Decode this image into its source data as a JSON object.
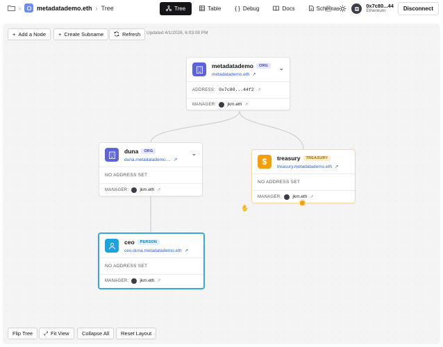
{
  "breadcrumb": {
    "name": "metadatademo.eth",
    "page": "Tree"
  },
  "nav": {
    "tabs": [
      {
        "label": "Tree",
        "icon": "tree-icon"
      },
      {
        "label": "Table",
        "icon": "table-icon"
      },
      {
        "label": "Debug",
        "icon": "code-icon"
      },
      {
        "label": "Docs",
        "icon": "book-icon"
      },
      {
        "label": "Schemas",
        "icon": "document-icon"
      }
    ]
  },
  "account": {
    "address": "0x7c80...44",
    "network": "Ethereum",
    "disconnect_label": "Disconnect"
  },
  "toolbar": {
    "add_node": "Add a Node",
    "create_subname": "Create Subname",
    "refresh": "Refresh",
    "updated": "Updated 4/1/2026, 6:03:08 PM"
  },
  "footer": {
    "flip_tree": "Flip Tree",
    "fit_view": "Fit View",
    "collapse_all": "Collapse All",
    "reset_layout": "Reset Layout"
  },
  "nodes": {
    "root": {
      "name": "metadatademo",
      "tag": "ORG",
      "sub": "metadatademo.eth",
      "address_label": "ADDRESS:",
      "address": "0x7c80...44f2",
      "manager_label": "MANAGER:",
      "manager": "jkm.eth"
    },
    "duna": {
      "name": "duna",
      "tag": "ORG",
      "sub": "duna.metadatademo....",
      "address": "NO ADDRESS SET",
      "manager_label": "MANAGER:",
      "manager": "jkm.eth"
    },
    "treasury": {
      "name": "treasury",
      "tag": "TREASURY",
      "sub": "treasury.metadatademo.eth",
      "address": "NO ADDRESS SET",
      "manager_label": "MANAGER:",
      "manager": "jkm.eth"
    },
    "ceo": {
      "name": "ceo",
      "tag": "PERSON",
      "sub": "ceo.duna.metadatademo.eth",
      "address": "NO ADDRESS SET",
      "manager_label": "MANAGER:",
      "manager": "jkm.eth"
    }
  },
  "colors": {
    "org": "#5c64d6",
    "person": "#1fa3dc",
    "treasury": "#f59e0b",
    "selected": "#38a6d8"
  }
}
